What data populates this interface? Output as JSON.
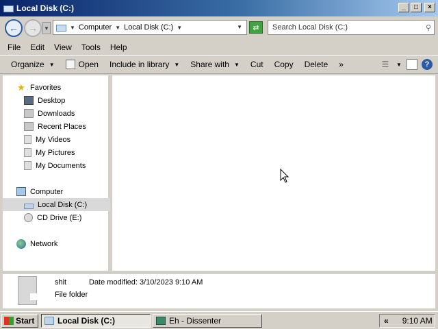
{
  "window": {
    "title": "Local Disk (C:)",
    "buttons": {
      "minimize": "_",
      "maximize": "□",
      "close": "×"
    }
  },
  "address": {
    "crumbs": [
      "Computer",
      "Local Disk (C:)"
    ],
    "search_placeholder": "Search Local Disk (C:)"
  },
  "menu": [
    "File",
    "Edit",
    "View",
    "Tools",
    "Help"
  ],
  "commands": {
    "organize": "Organize",
    "open": "Open",
    "include": "Include in library",
    "share": "Share with",
    "cut": "Cut",
    "copy": "Copy",
    "delete": "Delete",
    "more": "»"
  },
  "nav": {
    "favorites": "Favorites",
    "desktop": "Desktop",
    "downloads": "Downloads",
    "recent": "Recent Places",
    "videos": "My Videos",
    "pictures": "My Pictures",
    "documents": "My Documents",
    "computer": "Computer",
    "local_disk": "Local Disk (C:)",
    "cd_drive": "CD Drive (E:)",
    "network": "Network"
  },
  "details": {
    "name": "shit",
    "modified_label": "Date modified:",
    "modified_value": "3/10/2023 9:10 AM",
    "type": "File folder"
  },
  "taskbar": {
    "start": "Start",
    "task_active": "Local Disk (C:)",
    "task_other": "Eh - Dissenter",
    "tray_chevron": "«",
    "clock": "9:10 AM"
  }
}
